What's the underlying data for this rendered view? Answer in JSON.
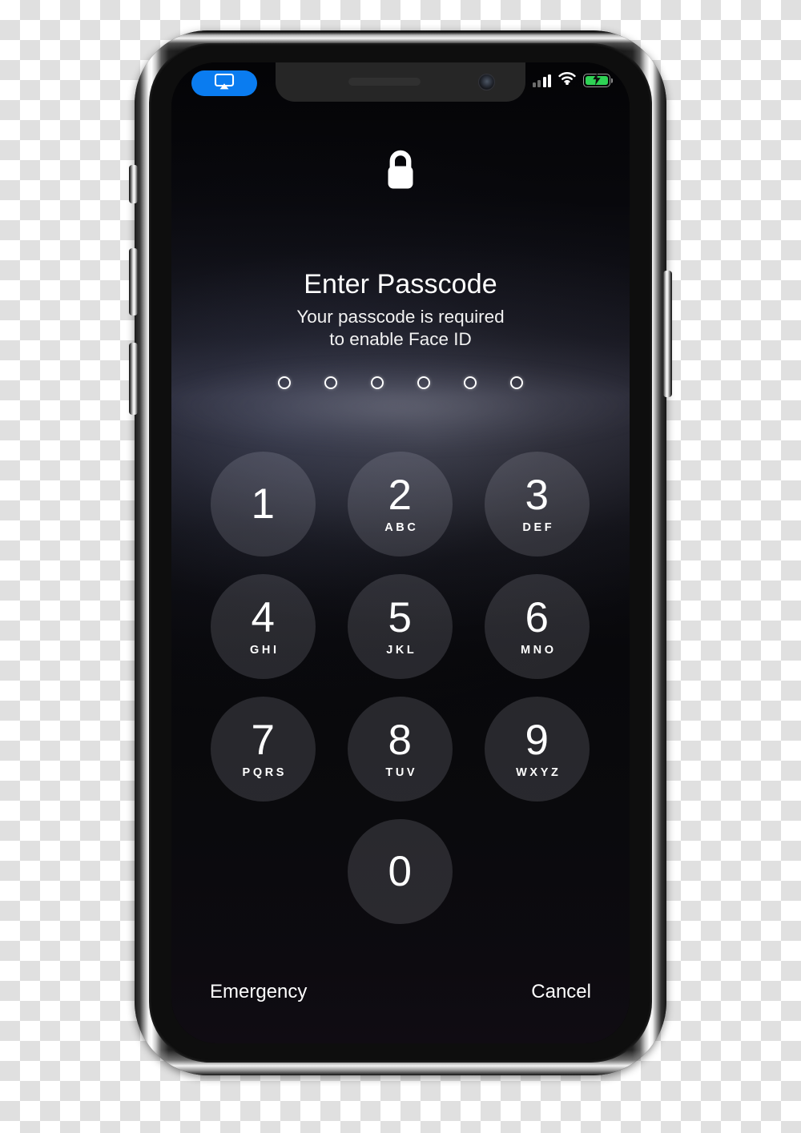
{
  "device": {
    "name": "iPhone",
    "hardware_buttons": [
      {
        "name": "silent-switch",
        "side": "left"
      },
      {
        "name": "volume-up-button",
        "side": "left"
      },
      {
        "name": "volume-down-button",
        "side": "left"
      },
      {
        "name": "power-button",
        "side": "right"
      }
    ]
  },
  "status_bar": {
    "airplay_badge": {
      "icon": "airplay-icon",
      "label": ""
    },
    "cellular": {
      "icon": "signal-bars-icon",
      "bars_total": 4,
      "bars_active": 2
    },
    "wifi": {
      "icon": "wifi-icon"
    },
    "battery": {
      "icon": "battery-charging-icon",
      "charging": true,
      "color": "#2fd255"
    }
  },
  "lock_screen": {
    "lock_icon": "lock-closed-icon",
    "title": "Enter Passcode",
    "subtitle_line1": "Your passcode is required",
    "subtitle_line2": "to enable Face ID",
    "passcode": {
      "length": 6,
      "entered": 0,
      "dots": [
        false,
        false,
        false,
        false,
        false,
        false
      ]
    },
    "keypad": [
      {
        "digit": "1",
        "letters": ""
      },
      {
        "digit": "2",
        "letters": "ABC"
      },
      {
        "digit": "3",
        "letters": "DEF"
      },
      {
        "digit": "4",
        "letters": "GHI"
      },
      {
        "digit": "5",
        "letters": "JKL"
      },
      {
        "digit": "6",
        "letters": "MNO"
      },
      {
        "digit": "7",
        "letters": "PQRS"
      },
      {
        "digit": "8",
        "letters": "TUV"
      },
      {
        "digit": "9",
        "letters": "WXYZ"
      },
      {
        "digit": "0",
        "letters": ""
      }
    ],
    "actions": {
      "emergency": "Emergency",
      "cancel": "Cancel"
    }
  },
  "colors": {
    "accent_blue": "#0a7cf0",
    "battery_green": "#2fd255",
    "key_fill": "rgba(235,235,245,0.14)",
    "text_primary": "#ffffff"
  }
}
